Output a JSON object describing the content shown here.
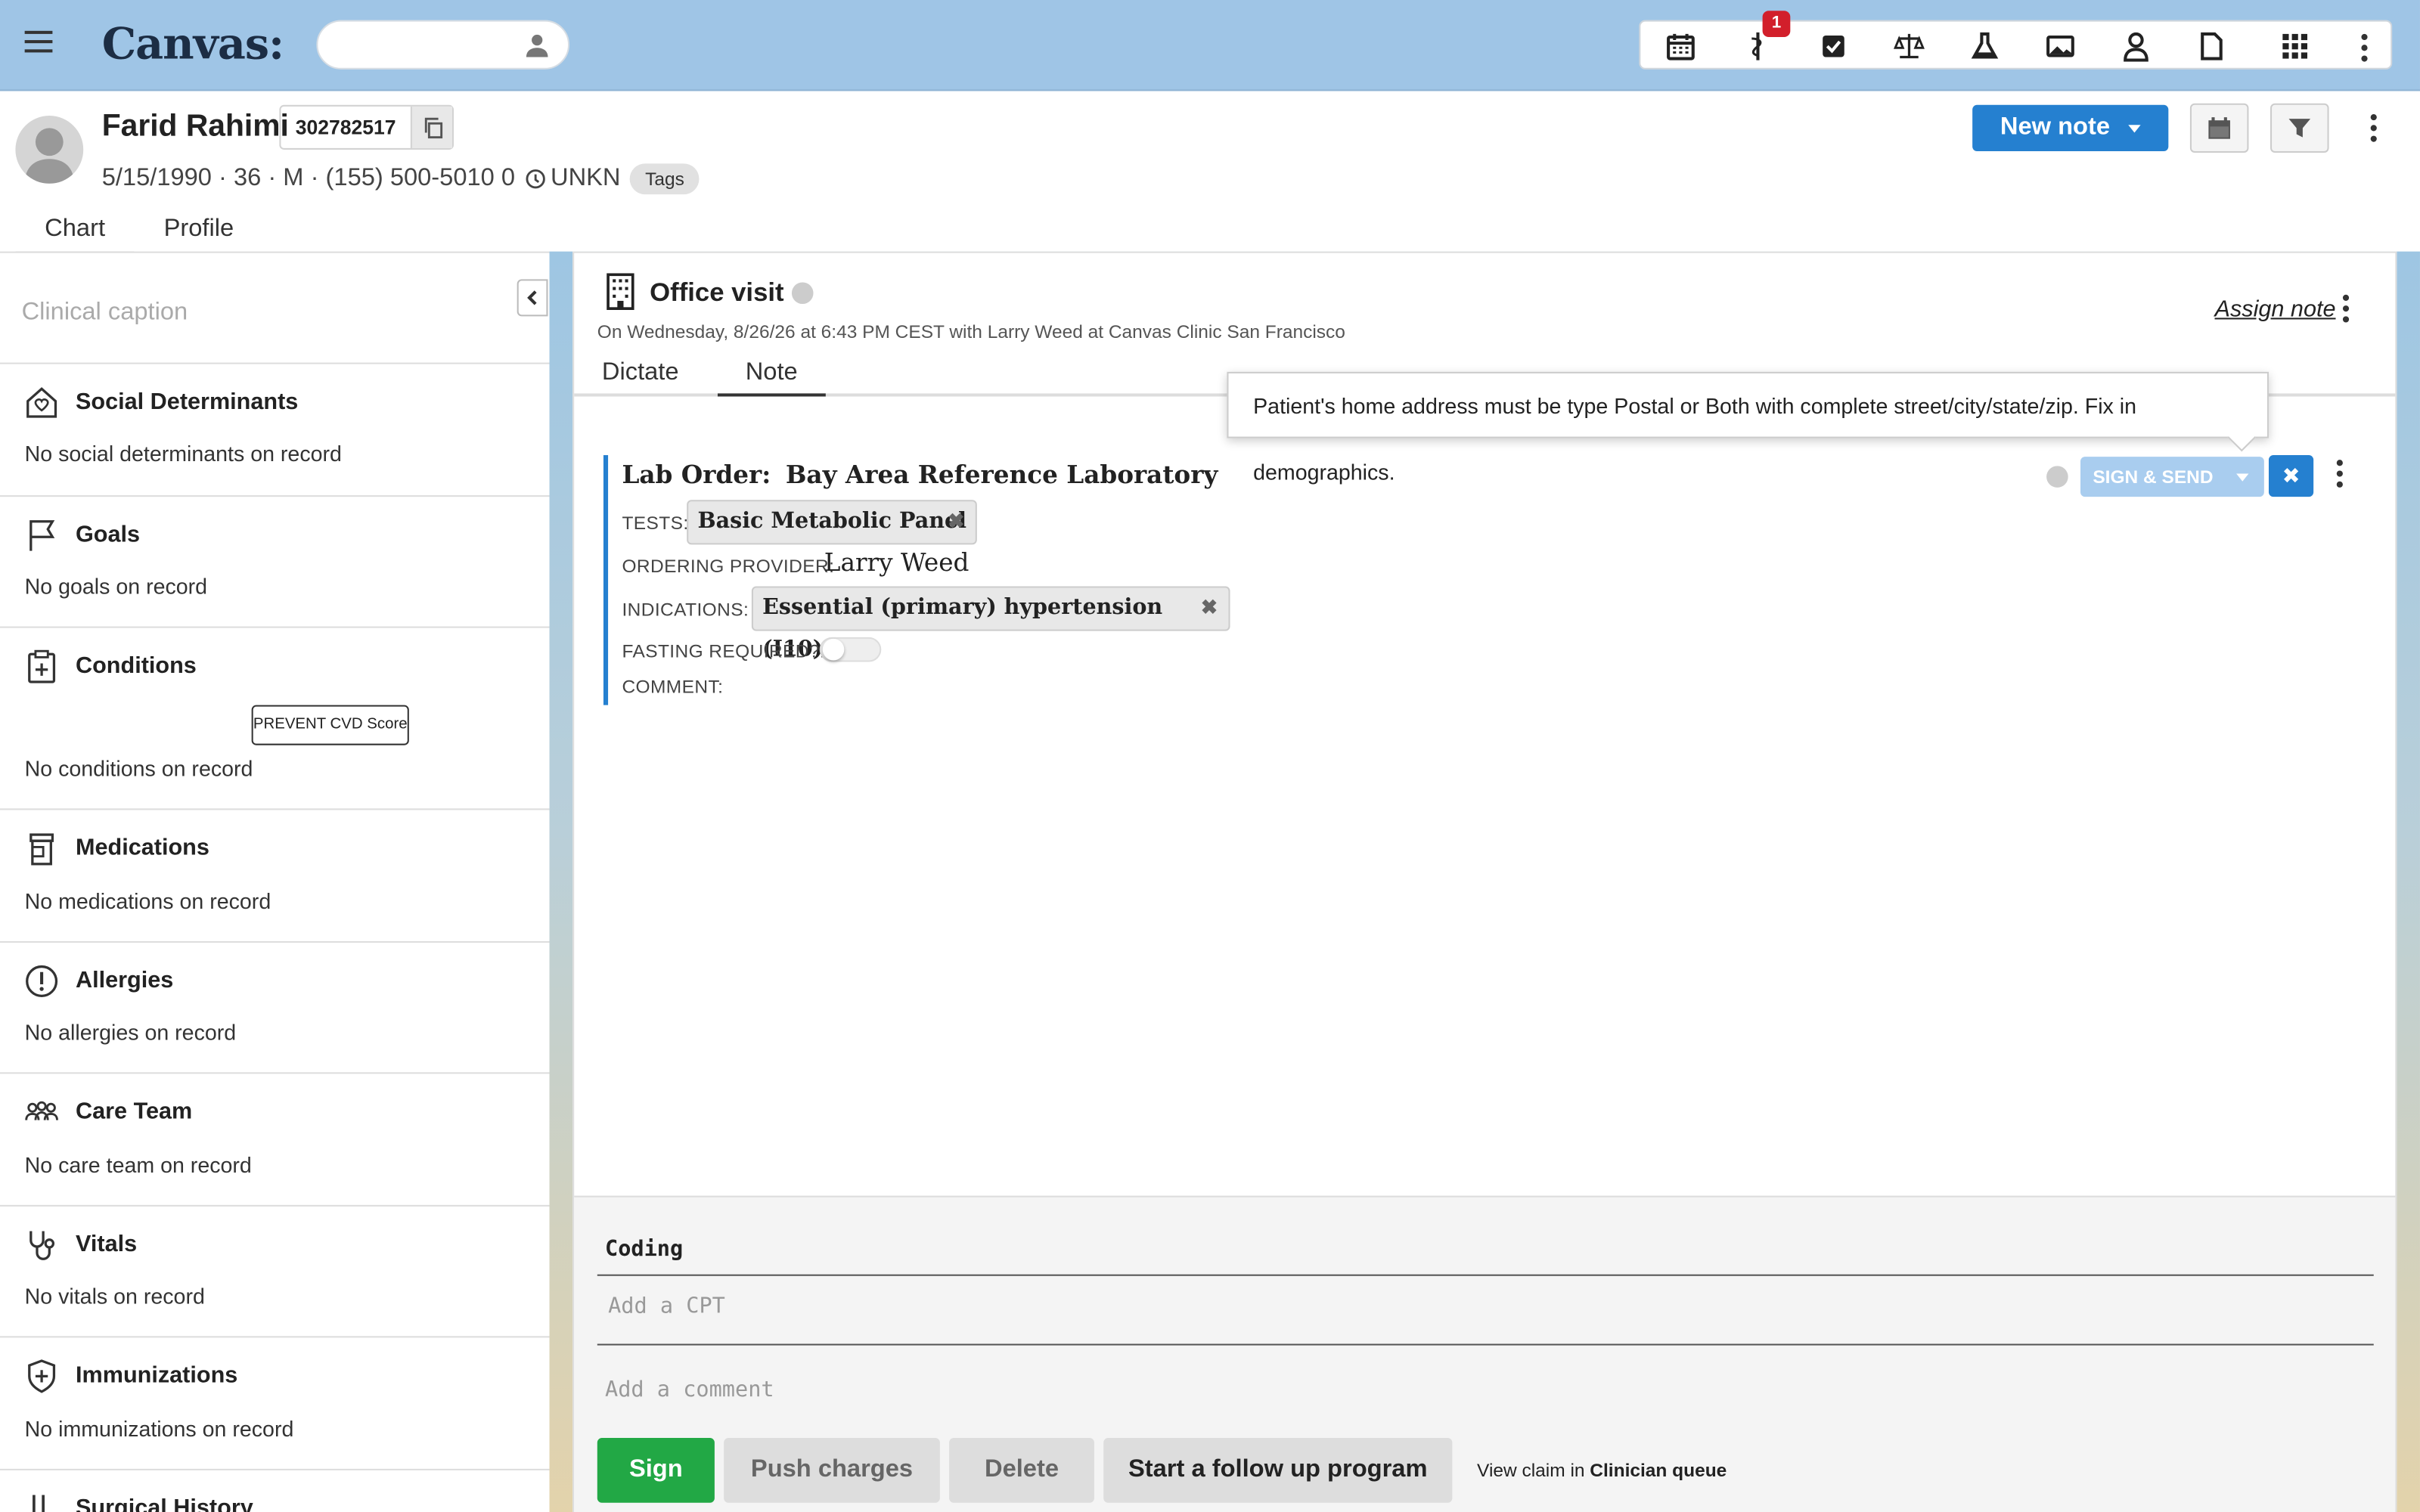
{
  "app": {
    "logo": "Canvas:",
    "notification_count": "1"
  },
  "patient": {
    "name": "Farid Rahimi",
    "id": "302782517",
    "meta": "5/15/1990 · 36 · M · (155) 500-5010 0",
    "timezone": "UNKN",
    "tags_label": "Tags"
  },
  "tabs": [
    "Chart",
    "Profile"
  ],
  "header_actions": {
    "new_note": "New note"
  },
  "sidebar": {
    "caption_placeholder": "Clinical caption",
    "sections": [
      {
        "title": "Social Determinants",
        "empty": "No social determinants on record",
        "icon": "house-heart-icon"
      },
      {
        "title": "Goals",
        "empty": "No goals on record",
        "icon": "flag-icon"
      },
      {
        "title": "Conditions",
        "empty": "No conditions on record",
        "icon": "clipboard-plus-icon",
        "button": "PREVENT CVD Score"
      },
      {
        "title": "Medications",
        "empty": "No medications on record",
        "icon": "pill-bottle-icon"
      },
      {
        "title": "Allergies",
        "empty": "No allergies on record",
        "icon": "alert-circle-icon"
      },
      {
        "title": "Care Team",
        "empty": "No care team on record",
        "icon": "people-icon"
      },
      {
        "title": "Vitals",
        "empty": "No vitals on record",
        "icon": "stethoscope-icon"
      },
      {
        "title": "Immunizations",
        "empty": "No immunizations on record",
        "icon": "shield-plus-icon"
      },
      {
        "title": "Surgical History",
        "empty": "",
        "icon": "surgical-tools-icon"
      }
    ]
  },
  "note": {
    "title": "Office visit",
    "subtitle": "On Wednesday, 8/26/26 at 6:43 PM CEST with Larry Weed at Canvas Clinic San Francisco",
    "assign": "Assign note",
    "tabs": [
      "Dictate",
      "Note"
    ],
    "tooltip": "Patient's home address must be type Postal or Both with complete street/city/state/zip. Fix in demographics."
  },
  "lab_order": {
    "title_prefix": "Lab Order:",
    "lab": "Bay Area Reference Laboratory",
    "tests_label": "TESTS:",
    "test": "Basic Metabolic Panel",
    "provider_label": "ORDERING PROVIDER:",
    "provider": "Larry Weed",
    "indications_label": "INDICATIONS:",
    "indication": "Essential (primary) hypertension (I10)",
    "fasting_label": "FASTING REQUIRED?:",
    "fasting": false,
    "comment_label": "COMMENT:",
    "sign_send": "SIGN & SEND",
    "remove": "✖"
  },
  "coding": {
    "title": "Coding",
    "cpt_placeholder": "Add a CPT",
    "comment_placeholder": "Add a comment"
  },
  "footer": {
    "sign": "Sign",
    "push": "Push charges",
    "delete": "Delete",
    "followup": "Start a follow up program",
    "claim_prefix": "View claim in ",
    "claim_link": "Clinician queue"
  },
  "colors": {
    "primary": "#2580d0",
    "sign": "#22a845",
    "topbar": "#9fc5e6",
    "badge": "#d21f2b"
  }
}
